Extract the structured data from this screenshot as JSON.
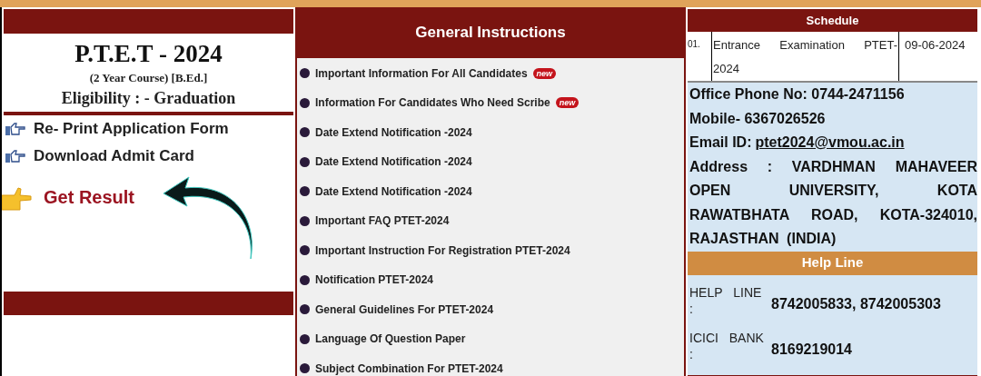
{
  "left_panel": {
    "title": "P.T.E.T - 2024",
    "subtitle": "(2 Year Course) [B.Ed.]",
    "eligibility": "Eligibility : - Graduation",
    "links": [
      {
        "label": "Re- Print Application Form"
      },
      {
        "label": "Download Admit Card"
      }
    ],
    "result_link": "Get Result"
  },
  "general_instructions": {
    "title": "General Instructions",
    "items": [
      {
        "label": "Important Information For All Candidates",
        "new_badge": "new"
      },
      {
        "label": "Information For Candidates Who Need Scribe",
        "new_badge": "new"
      },
      {
        "label": "Date Extend Notification -2024"
      },
      {
        "label": "Date Extend Notification -2024"
      },
      {
        "label": "Date Extend Notification -2024"
      },
      {
        "label": "Important FAQ PTET-2024"
      },
      {
        "label": "Important Instruction For Registration PTET-2024"
      },
      {
        "label": "Notification PTET-2024"
      },
      {
        "label": "General Guidelines For PTET-2024"
      },
      {
        "label": "Language Of Question Paper"
      },
      {
        "label": "Subject Combination For PTET-2024"
      }
    ]
  },
  "schedule": {
    "title": "Schedule",
    "rows": [
      {
        "number": "01.",
        "event": "Entrance Examination PTET-2024",
        "date": "09-06-2024"
      }
    ]
  },
  "contact": {
    "office_phone": "Office Phone No: 0744-2471156",
    "mobile": "Mobile- 6367026526",
    "email_label": "Email ID:",
    "email": "ptet2024@vmou.ac.in",
    "address": "Address : VARDHMAN MAHAVEER OPEN UNIVERSITY, KOTA RAWATBHATA ROAD, KOTA-324010, RAJASTHAN (INDIA)"
  },
  "help_line": {
    "title": "Help Line",
    "rows": [
      {
        "label": "HELP LINE :",
        "value": "8742005833, 8742005303"
      },
      {
        "label": "ICICI BANK :",
        "value": "8169219014"
      }
    ]
  }
}
